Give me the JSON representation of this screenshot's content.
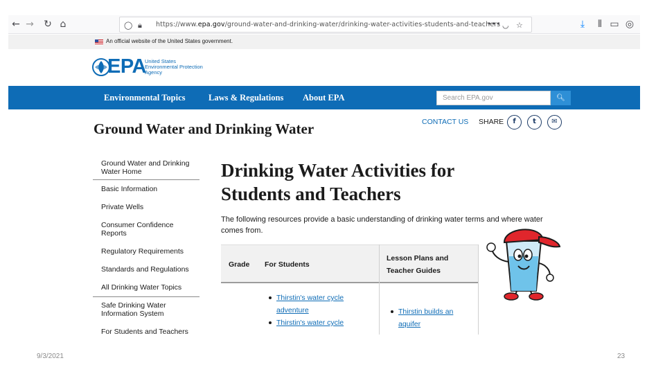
{
  "browser": {
    "url_prefix": "https://www.",
    "url_domain": "epa.gov",
    "url_path": "/ground-water-and-drinking-water/drinking-water-activities-students-and-teachers",
    "page_actions_icon": "•••"
  },
  "gov_banner": {
    "text": "An official website of the United States government."
  },
  "logo": {
    "word": "EPA",
    "subtitle_line1": "United States",
    "subtitle_line2": "Environmental Protection",
    "subtitle_line3": "Agency",
    "color": "#0e6cb6"
  },
  "nav": {
    "items": [
      "Environmental Topics",
      "Laws & Regulations",
      "About EPA"
    ],
    "search_placeholder": "Search EPA.gov",
    "background": "#0e6cb6"
  },
  "header": {
    "section_title": "Ground Water and Drinking Water",
    "contact_label": "CONTACT US",
    "share_label": "SHARE"
  },
  "sidebar": {
    "items": [
      {
        "label_line1": "Ground Water and Drinking",
        "label_line2": "Water Home"
      },
      {
        "label_line1": "Basic Information",
        "label_line2": ""
      },
      {
        "label_line1": "Private Wells",
        "label_line2": ""
      },
      {
        "label_line1": "Consumer Confidence",
        "label_line2": "Reports"
      },
      {
        "label_line1": "Regulatory Requirements",
        "label_line2": ""
      },
      {
        "label_line1": "Standards and Regulations",
        "label_line2": ""
      },
      {
        "label_line1": "All Drinking Water Topics",
        "label_line2": ""
      },
      {
        "label_line1": "Safe Drinking Water",
        "label_line2": "Information System"
      },
      {
        "label_line1": "For Students and Teachers",
        "label_line2": ""
      }
    ]
  },
  "main": {
    "title_line1": "Drinking Water Activities for",
    "title_line2": "Students and Teachers",
    "intro": "The following resources provide a basic understanding of drinking water terms and where water comes from."
  },
  "table": {
    "headers": {
      "grade": "Grade",
      "students": "For Students",
      "teachers_line1": "Lesson Plans and",
      "teachers_line2": "Teacher Guides"
    },
    "students_links": [
      {
        "line1": "Thirstin's water cycle",
        "line2": "adventure"
      },
      {
        "line1": "Thirstin's water cycle",
        "line2": ""
      }
    ],
    "teacher_links": [
      {
        "line1": "Thirstin builds an",
        "line2": "aquifer"
      }
    ]
  },
  "slide": {
    "date": "9/3/2021",
    "page_number": "23"
  }
}
